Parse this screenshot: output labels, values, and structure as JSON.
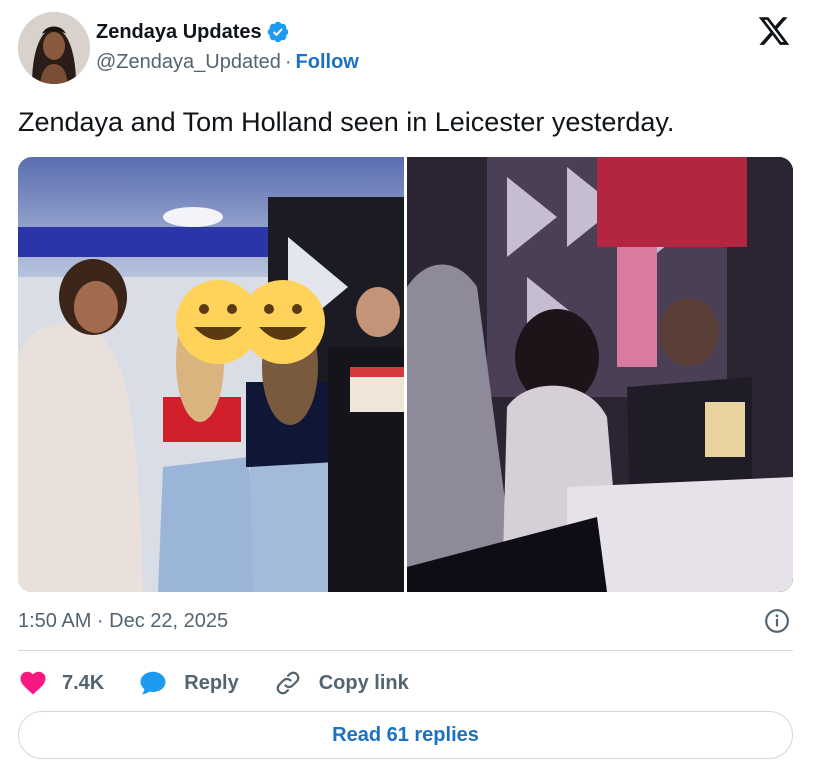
{
  "author": {
    "display_name": "Zendaya Updates",
    "handle": "@Zendaya_Updated",
    "separator": "·",
    "follow_label": "Follow",
    "verified": true
  },
  "tweet": {
    "text": "Zendaya and Tom Holland seen in Leicester yesterday.",
    "timestamp": "1:50 AM · Dec 22, 2025",
    "media": [
      {
        "icon": "photo",
        "description_icon": "group-photo"
      },
      {
        "icon": "photo",
        "description_icon": "bar-photo"
      }
    ]
  },
  "actions": {
    "like_count": "7.4K",
    "reply_label": "Reply",
    "copy_link_label": "Copy link"
  },
  "footer": {
    "read_replies_label": "Read 61 replies"
  },
  "colors": {
    "accent": "#1d9bf0",
    "link": "#1d71c3",
    "like": "#f91880",
    "muted": "#536471",
    "text": "#0f1419",
    "border": "#cfd9de"
  },
  "icons": {
    "brand": "x-logo-icon",
    "verified": "verified-badge-icon",
    "info": "info-icon",
    "like": "heart-icon",
    "reply": "speech-bubble-icon",
    "copy": "link-icon"
  }
}
